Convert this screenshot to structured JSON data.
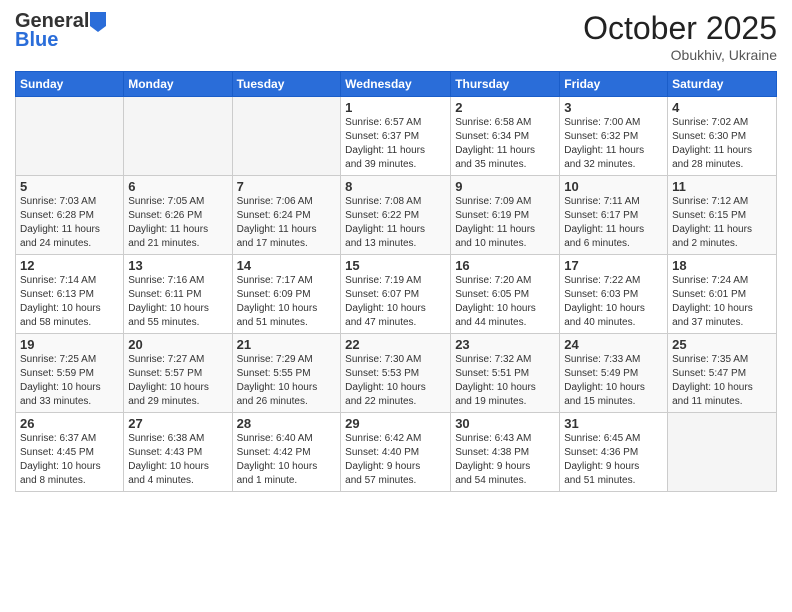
{
  "logo": {
    "general": "General",
    "blue": "Blue"
  },
  "title": "October 2025",
  "subtitle": "Obukhiv, Ukraine",
  "days_header": [
    "Sunday",
    "Monday",
    "Tuesday",
    "Wednesday",
    "Thursday",
    "Friday",
    "Saturday"
  ],
  "weeks": [
    [
      {
        "day": "",
        "info": ""
      },
      {
        "day": "",
        "info": ""
      },
      {
        "day": "",
        "info": ""
      },
      {
        "day": "1",
        "info": "Sunrise: 6:57 AM\nSunset: 6:37 PM\nDaylight: 11 hours\nand 39 minutes."
      },
      {
        "day": "2",
        "info": "Sunrise: 6:58 AM\nSunset: 6:34 PM\nDaylight: 11 hours\nand 35 minutes."
      },
      {
        "day": "3",
        "info": "Sunrise: 7:00 AM\nSunset: 6:32 PM\nDaylight: 11 hours\nand 32 minutes."
      },
      {
        "day": "4",
        "info": "Sunrise: 7:02 AM\nSunset: 6:30 PM\nDaylight: 11 hours\nand 28 minutes."
      }
    ],
    [
      {
        "day": "5",
        "info": "Sunrise: 7:03 AM\nSunset: 6:28 PM\nDaylight: 11 hours\nand 24 minutes."
      },
      {
        "day": "6",
        "info": "Sunrise: 7:05 AM\nSunset: 6:26 PM\nDaylight: 11 hours\nand 21 minutes."
      },
      {
        "day": "7",
        "info": "Sunrise: 7:06 AM\nSunset: 6:24 PM\nDaylight: 11 hours\nand 17 minutes."
      },
      {
        "day": "8",
        "info": "Sunrise: 7:08 AM\nSunset: 6:22 PM\nDaylight: 11 hours\nand 13 minutes."
      },
      {
        "day": "9",
        "info": "Sunrise: 7:09 AM\nSunset: 6:19 PM\nDaylight: 11 hours\nand 10 minutes."
      },
      {
        "day": "10",
        "info": "Sunrise: 7:11 AM\nSunset: 6:17 PM\nDaylight: 11 hours\nand 6 minutes."
      },
      {
        "day": "11",
        "info": "Sunrise: 7:12 AM\nSunset: 6:15 PM\nDaylight: 11 hours\nand 2 minutes."
      }
    ],
    [
      {
        "day": "12",
        "info": "Sunrise: 7:14 AM\nSunset: 6:13 PM\nDaylight: 10 hours\nand 58 minutes."
      },
      {
        "day": "13",
        "info": "Sunrise: 7:16 AM\nSunset: 6:11 PM\nDaylight: 10 hours\nand 55 minutes."
      },
      {
        "day": "14",
        "info": "Sunrise: 7:17 AM\nSunset: 6:09 PM\nDaylight: 10 hours\nand 51 minutes."
      },
      {
        "day": "15",
        "info": "Sunrise: 7:19 AM\nSunset: 6:07 PM\nDaylight: 10 hours\nand 47 minutes."
      },
      {
        "day": "16",
        "info": "Sunrise: 7:20 AM\nSunset: 6:05 PM\nDaylight: 10 hours\nand 44 minutes."
      },
      {
        "day": "17",
        "info": "Sunrise: 7:22 AM\nSunset: 6:03 PM\nDaylight: 10 hours\nand 40 minutes."
      },
      {
        "day": "18",
        "info": "Sunrise: 7:24 AM\nSunset: 6:01 PM\nDaylight: 10 hours\nand 37 minutes."
      }
    ],
    [
      {
        "day": "19",
        "info": "Sunrise: 7:25 AM\nSunset: 5:59 PM\nDaylight: 10 hours\nand 33 minutes."
      },
      {
        "day": "20",
        "info": "Sunrise: 7:27 AM\nSunset: 5:57 PM\nDaylight: 10 hours\nand 29 minutes."
      },
      {
        "day": "21",
        "info": "Sunrise: 7:29 AM\nSunset: 5:55 PM\nDaylight: 10 hours\nand 26 minutes."
      },
      {
        "day": "22",
        "info": "Sunrise: 7:30 AM\nSunset: 5:53 PM\nDaylight: 10 hours\nand 22 minutes."
      },
      {
        "day": "23",
        "info": "Sunrise: 7:32 AM\nSunset: 5:51 PM\nDaylight: 10 hours\nand 19 minutes."
      },
      {
        "day": "24",
        "info": "Sunrise: 7:33 AM\nSunset: 5:49 PM\nDaylight: 10 hours\nand 15 minutes."
      },
      {
        "day": "25",
        "info": "Sunrise: 7:35 AM\nSunset: 5:47 PM\nDaylight: 10 hours\nand 11 minutes."
      }
    ],
    [
      {
        "day": "26",
        "info": "Sunrise: 6:37 AM\nSunset: 4:45 PM\nDaylight: 10 hours\nand 8 minutes."
      },
      {
        "day": "27",
        "info": "Sunrise: 6:38 AM\nSunset: 4:43 PM\nDaylight: 10 hours\nand 4 minutes."
      },
      {
        "day": "28",
        "info": "Sunrise: 6:40 AM\nSunset: 4:42 PM\nDaylight: 10 hours\nand 1 minute."
      },
      {
        "day": "29",
        "info": "Sunrise: 6:42 AM\nSunset: 4:40 PM\nDaylight: 9 hours\nand 57 minutes."
      },
      {
        "day": "30",
        "info": "Sunrise: 6:43 AM\nSunset: 4:38 PM\nDaylight: 9 hours\nand 54 minutes."
      },
      {
        "day": "31",
        "info": "Sunrise: 6:45 AM\nSunset: 4:36 PM\nDaylight: 9 hours\nand 51 minutes."
      },
      {
        "day": "",
        "info": ""
      }
    ]
  ]
}
